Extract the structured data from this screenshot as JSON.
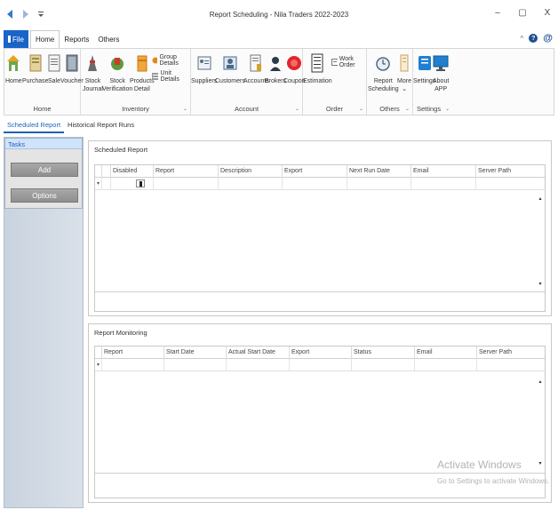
{
  "window": {
    "title": "Report Scheduling - Nila Traders 2022-2023",
    "controls": [
      "–",
      "▢",
      "X"
    ]
  },
  "menu": {
    "file": "File",
    "tabs": [
      "Home",
      "Reports",
      "Others"
    ],
    "right_caret": "^"
  },
  "ribbon": {
    "home_group": {
      "label": "Home",
      "buttons": [
        "Home",
        "Purchase",
        "Sale",
        "Voucher"
      ]
    },
    "inventory_group": {
      "label": "Inventory",
      "buttons": [
        {
          "line1": "Stock",
          "line2": "Journal"
        },
        {
          "line1": "Stock",
          "line2": "Verification"
        },
        {
          "line1": "Products",
          "line2": "Detail"
        }
      ],
      "small_buttons": [
        "Group Details",
        "Unit Details"
      ]
    },
    "account_group": {
      "label": "Account",
      "buttons": [
        "Suppliers",
        "Customers",
        "Accounts",
        "Brokers",
        "Coupon"
      ]
    },
    "order_group": {
      "label": "Order",
      "buttons": [
        "Estimation"
      ],
      "small_buttons": [
        "Work Order"
      ]
    },
    "others_group": {
      "label": "Others",
      "buttons": [
        {
          "line1": "Report",
          "line2": "Scheduling"
        },
        {
          "line1": "More",
          "line2": "⌄"
        }
      ]
    },
    "settings_group": {
      "label": "Settings",
      "buttons": [
        {
          "line1": "Settings",
          "line2": ""
        },
        {
          "line1": "About",
          "line2": "APP"
        }
      ]
    }
  },
  "doc_tabs": [
    "Scheduled Report",
    "Historical Report Runs"
  ],
  "tasks": {
    "header": "Tasks",
    "add": "Add",
    "options": "Options"
  },
  "scheduled": {
    "title": "Scheduled Report",
    "columns": [
      "Disabled",
      "Report",
      "Description",
      "Export",
      "Next Run Date",
      "Email",
      "Server Path"
    ]
  },
  "monitoring": {
    "title": "Report Monitoring",
    "columns": [
      "Report",
      "Start Date",
      "Actual Start Date",
      "Export",
      "Status",
      "Email",
      "Server Path"
    ]
  },
  "watermark": {
    "line1": "Activate Windows",
    "line2": "Go to Settings to activate Windows."
  }
}
